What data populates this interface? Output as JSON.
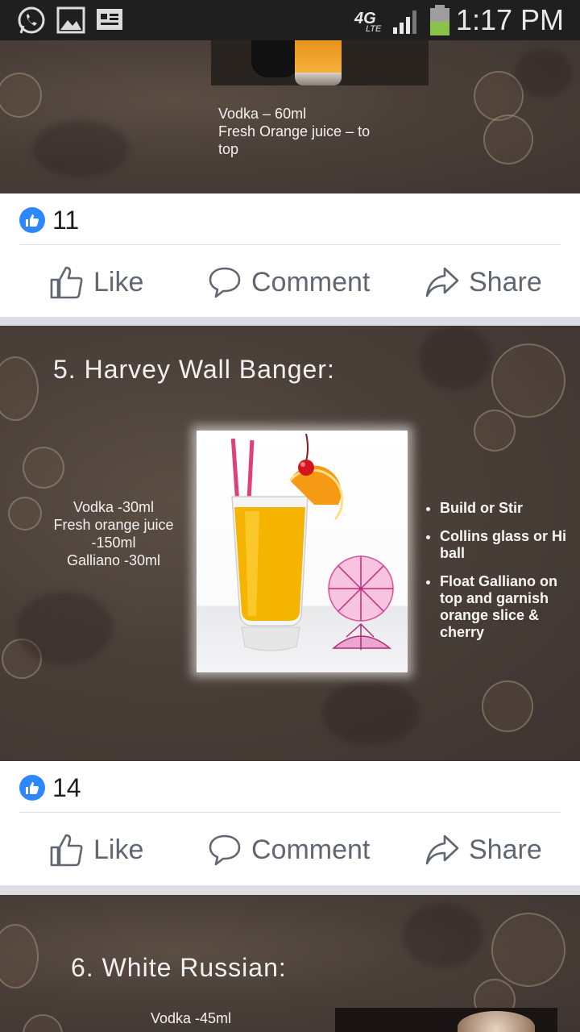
{
  "status_bar": {
    "network": "4G",
    "network_sub": "LTE",
    "time": "1:17 PM"
  },
  "posts": [
    {
      "ingredients": [
        "Vodka – 60ml",
        "Fresh Orange juice – to",
        "top"
      ],
      "like_count": "11"
    },
    {
      "title": "5. Harvey Wall Banger:",
      "ingredients": [
        "Vodka -30ml",
        "Fresh orange juice",
        "-150ml",
        "Galliano -30ml"
      ],
      "bullets": [
        "Build or Stir",
        "Collins glass or Hi ball",
        "Float Galliano on top and garnish orange slice & cherry"
      ],
      "like_count": "14"
    },
    {
      "title": "6. White Russian:",
      "ingredients": [
        "Vodka -45ml"
      ]
    }
  ],
  "actions": {
    "like": "Like",
    "comment": "Comment",
    "share": "Share"
  },
  "icons": [
    "whatsapp-icon",
    "gallery-icon",
    "news-icon",
    "signal-icon",
    "battery-icon",
    "thumbs-up-icon",
    "comment-icon",
    "share-icon"
  ],
  "colors": {
    "like_blue": "#2d88ff",
    "action_gray": "#606770",
    "status_bar": "#1f1f1f",
    "battery_green": "#8bc34a"
  }
}
